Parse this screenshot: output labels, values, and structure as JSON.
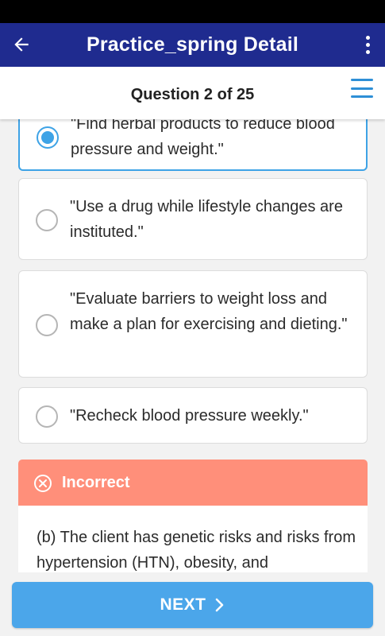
{
  "app_bar": {
    "title": "Practice_spring Detail",
    "back_icon": "arrow-left-icon",
    "menu_icon": "more-vert-icon"
  },
  "sub_header": {
    "question_count": "Question 2 of 25",
    "menu_icon": "hamburger-menu-icon"
  },
  "options": [
    {
      "text": "\"Find herbal products to reduce blood pressure and weight.\"",
      "visible_text": "pressure and weight.\"",
      "clipped_top_text": "\"Find herbal products to reduce blood",
      "selected": true
    },
    {
      "text": "\"Use a drug while lifestyle changes are instituted.\"",
      "selected": false
    },
    {
      "text": "\"Evaluate barriers to weight loss and make a plan for exercising and dieting.\"",
      "selected": false
    },
    {
      "text": "\"Recheck blood pressure weekly.\"",
      "selected": false
    }
  ],
  "feedback": {
    "label": "Incorrect",
    "icon": "x-circle-icon",
    "text": "(b) The client has genetic risks and risks from hypertension (HTN), obesity, and"
  },
  "next_button": {
    "label": "NEXT",
    "icon": "chevron-right-icon"
  },
  "colors": {
    "app_bar": "#1f2b8f",
    "accent": "#3ea3e6",
    "incorrect": "#ff8f7a",
    "next_button": "#4ba6ea"
  }
}
